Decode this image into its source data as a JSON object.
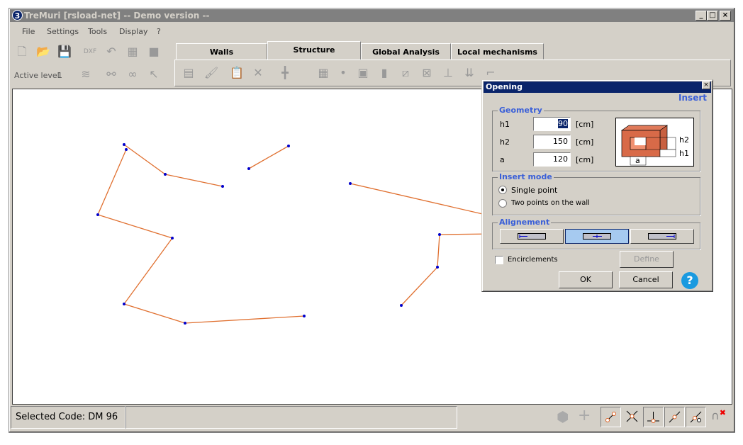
{
  "window": {
    "title": "TreMuri  [rsload-net] -- Demo version --",
    "icon_text": "3",
    "min": "_",
    "max": "□",
    "close": "×"
  },
  "menu": [
    "File",
    "Settings",
    "Tools",
    "Display",
    "?"
  ],
  "toolbar": {
    "active_level_label": "Active level",
    "active_level_value": "1"
  },
  "tabs": [
    {
      "label": "Walls",
      "active": false
    },
    {
      "label": "Structure",
      "active": true
    },
    {
      "label": "Global Analysis",
      "active": false
    },
    {
      "label": "Local mechanisms",
      "active": false
    }
  ],
  "dialog": {
    "title": "Opening",
    "close": "×",
    "mode": "Insert",
    "geometry": {
      "label": "Geometry",
      "fields": [
        {
          "name": "h1",
          "value": "90",
          "unit": "[cm]"
        },
        {
          "name": "h2",
          "value": "150",
          "unit": "[cm]"
        },
        {
          "name": "a",
          "value": "120",
          "unit": "[cm]"
        }
      ],
      "diagram_labels": {
        "h2": "h2",
        "h1": "h1",
        "a": "a"
      }
    },
    "insert_mode": {
      "label": "Insert mode",
      "options": [
        {
          "label": "Single point",
          "checked": true
        },
        {
          "label": "Two points on the wall",
          "checked": false
        }
      ]
    },
    "alignment": {
      "label": "Alignement",
      "options": [
        "left",
        "center",
        "right"
      ],
      "selected": "center"
    },
    "encirclements": {
      "label": "Encirclements",
      "checked": false
    },
    "define": "Define",
    "ok": "OK",
    "cancel": "Cancel",
    "help": "?"
  },
  "status": {
    "selected_code": "Selected Code: DM 96"
  },
  "colors": {
    "wall": "#e07030",
    "node": "#0000cc",
    "accent": "#3a5fd8",
    "titlebar_active": "#0a246a"
  }
}
